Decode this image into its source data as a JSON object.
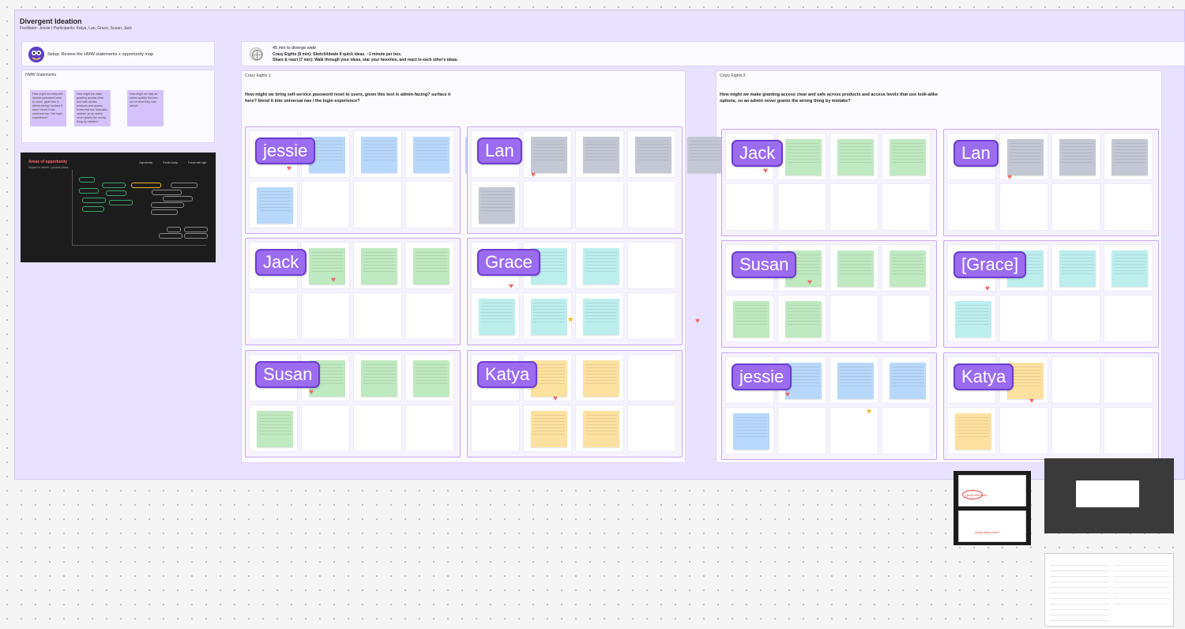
{
  "board": {
    "title": "Divergent Ideation",
    "subtitle": "Facilitator: Jessie  |  Participants: Katya, Lan, Grace, Susan, Jack"
  },
  "setup": {
    "text": "Setup: Review the HMW statements + opportunity map"
  },
  "instructions": {
    "line1": "45 min to diverge wide",
    "line2": "Crazy Eights (8 min): Sketch/ideate 8 quick ideas. ~1 minute per box.",
    "line3": "Share & react (7 min): Walk through your ideas, star your favorites, and react to each other's ideas."
  },
  "hmw": {
    "label": "HMW Statements",
    "cards": [
      "How might we bring self-service password reset to users, given this is admin-facing? surface it here? blend it into universal nav / the login experience?",
      "How might we make granting access clear and safe across products and access levels that use look-alike options, so an admin never grants the wrong thing by mistake?",
      "How might we help an admin quickly find and act on what they care about?"
    ]
  },
  "opportunity": {
    "title": "Areas of opportunity",
    "subtitle": "Impact on admin / product pillars",
    "legend": [
      "Opportunity",
      "Painful today",
      "Future with light"
    ]
  },
  "sections": [
    {
      "title": "Crazy Eights 1",
      "question": "How might we bring self-service password reset to users, given this tool is admin-facing? surface it here? blend it into universal nav / the login experience?"
    },
    {
      "title": "Crazy Eights 2",
      "question": "How might we make granting access clear and safe across products and access levels that use look-alike options, so an admin never grants the wrong thing by mistake?"
    }
  ],
  "participants": {
    "s1": [
      "jessie",
      "Lan",
      "Jack",
      "Grace",
      "Susan",
      "Katya"
    ],
    "s2": [
      "Jack",
      "Lan",
      "Susan",
      "[Grace]",
      "jessie",
      "Katya"
    ]
  },
  "colors": {
    "blue": "#b8d8fb",
    "gray": "#c3c8d4",
    "green": "#bfe9c0",
    "teal": "#bdeeee",
    "yellow": "#fde1a0",
    "purple": "#d4c3fb",
    "nametag": "#9c6cf0"
  },
  "screens": {
    "annotation1": "Quick Win here",
    "annotation2": "Quick Wins here?"
  }
}
